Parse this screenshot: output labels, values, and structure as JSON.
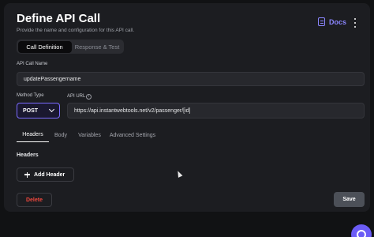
{
  "header": {
    "title": "Define API Call",
    "subtitle": "Provide the name and configuration for this API call.",
    "docs_label": "Docs"
  },
  "mode_tabs": [
    {
      "label": "Call Definition",
      "active": true
    },
    {
      "label": "Response & Test",
      "active": false
    }
  ],
  "form": {
    "name_label": "API Call Name",
    "name_value": "updatePassengername",
    "method_label": "Method Type",
    "method_value": "POST",
    "url_label": "API URL",
    "url_value": "https://api.instantwebtools.net/v2/passenger/[id]"
  },
  "sub_tabs": [
    {
      "label": "Headers",
      "active": true
    },
    {
      "label": "Body",
      "active": false
    },
    {
      "label": "Variables",
      "active": false
    },
    {
      "label": "Advanced Settings",
      "active": false
    }
  ],
  "headers_section": {
    "title": "Headers",
    "add_label": "Add Header"
  },
  "footer": {
    "delete_label": "Delete",
    "save_label": "Save"
  },
  "colors": {
    "accent": "#7b6cff",
    "danger": "#f0483e",
    "panel": "#1c1d21"
  },
  "icons": [
    "docs-icon",
    "more-vertical-icon",
    "info-icon",
    "chevron-down-icon",
    "plus-icon",
    "chat-icon"
  ]
}
